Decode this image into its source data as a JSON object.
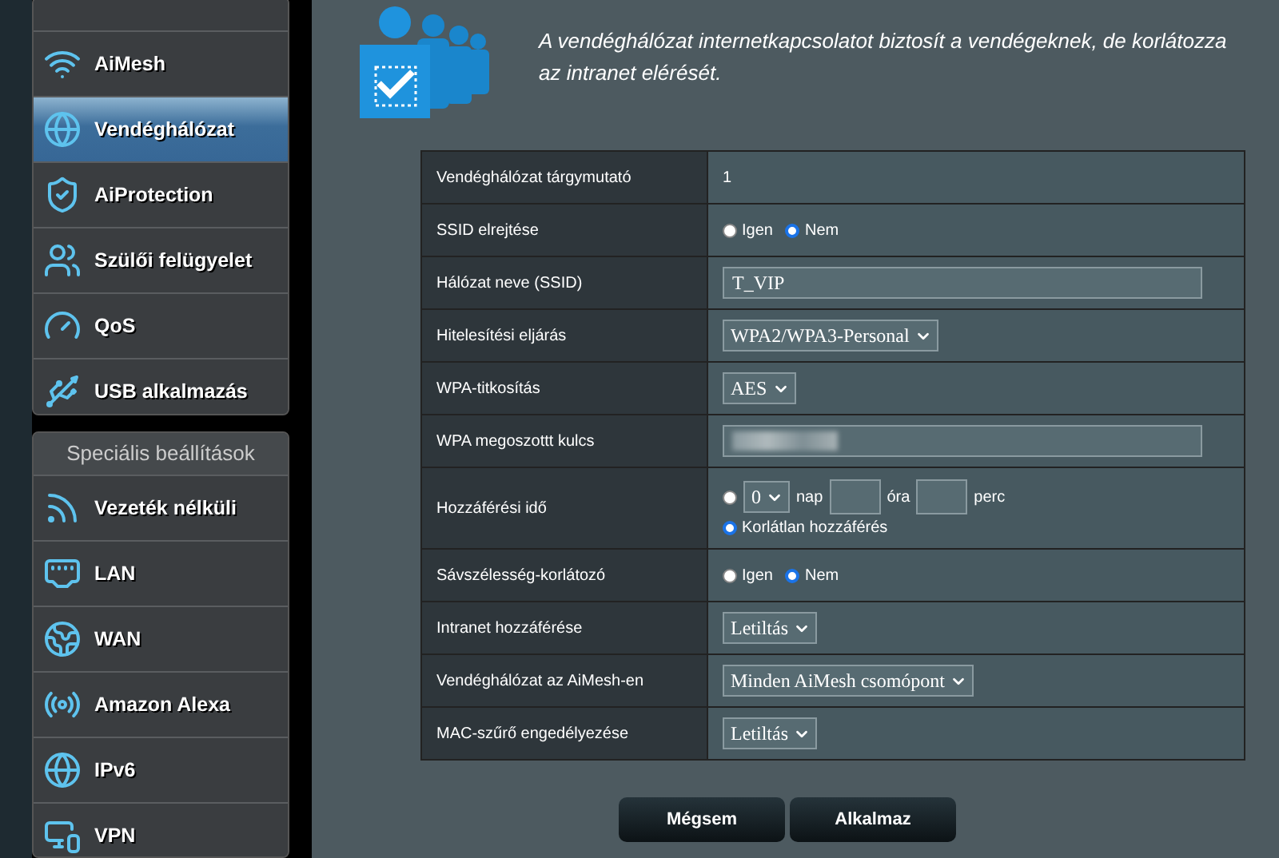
{
  "sidebar": {
    "items": [
      {
        "label": "AiMesh",
        "selected": false
      },
      {
        "label": "Vendéghálózat",
        "selected": true
      },
      {
        "label": "AiProtection",
        "selected": false
      },
      {
        "label": "Szülői felügyelet",
        "selected": false
      },
      {
        "label": "QoS",
        "selected": false
      },
      {
        "label": "USB alkalmazás",
        "selected": false
      }
    ],
    "section": {
      "title": "Speciális beállítások",
      "items": [
        {
          "label": "Vezeték nélküli",
          "selected": false
        },
        {
          "label": "LAN",
          "selected": false
        },
        {
          "label": "WAN",
          "selected": false
        },
        {
          "label": "Amazon Alexa",
          "selected": false
        },
        {
          "label": "IPv6",
          "selected": false
        },
        {
          "label": "VPN",
          "selected": false
        }
      ]
    }
  },
  "intro": "A vendéghálózat internetkapcsolatot biztosít a vendégeknek, de korlátozza az intranet elérését.",
  "form": {
    "rows": [
      {
        "kind": "text",
        "label": "Vendéghálózat tárgymutató",
        "value": "1"
      },
      {
        "kind": "radio",
        "label": "SSID elrejtése",
        "options": [
          {
            "label": "Igen",
            "selected": false
          },
          {
            "label": "Nem",
            "selected": true
          }
        ]
      },
      {
        "kind": "input",
        "label": "Hálózat neve (SSID)",
        "value": "T_VIP"
      },
      {
        "kind": "select",
        "label": "Hitelesítési eljárás",
        "value": "WPA2/WPA3-Personal"
      },
      {
        "kind": "select",
        "label": "WPA-titkosítás",
        "value": "AES"
      },
      {
        "kind": "hidden",
        "label": "WPA megoszottt kulcs"
      },
      {
        "kind": "time",
        "label": "Hozzáférési idő",
        "timed": {
          "selected": false,
          "days": "0",
          "day_unit": "nap",
          "hour_unit": "óra",
          "minute_unit": "perc"
        },
        "unlimited": {
          "label": "Korlátlan hozzáférés",
          "selected": true
        }
      },
      {
        "kind": "radio",
        "label": "Sávszélesség-korlátozó",
        "options": [
          {
            "label": "Igen",
            "selected": false
          },
          {
            "label": "Nem",
            "selected": true
          }
        ]
      },
      {
        "kind": "select",
        "label": "Intranet hozzáférése",
        "value": "Letiltás"
      },
      {
        "kind": "select",
        "label": "Vendéghálózat az AiMesh-en",
        "value": "Minden AiMesh csomópont"
      },
      {
        "kind": "select",
        "label": "MAC-szűrő engedélyezése",
        "value": "Letiltás"
      }
    ]
  },
  "buttons": [
    "Mégsem",
    "Alkalmaz"
  ]
}
